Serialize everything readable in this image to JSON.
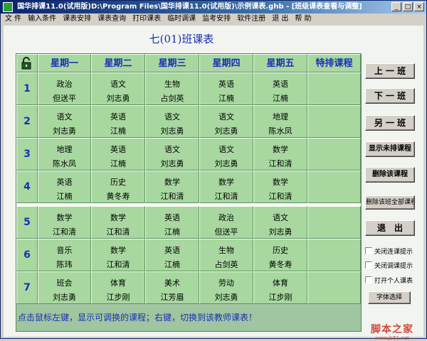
{
  "window": {
    "title": "国华排课11.0(试用版)D:\\Program Files\\国华排课11.0(试用版)\\示例课表.ghb - [班级课表查看与调整]",
    "buttons": [
      "_",
      "□",
      "×"
    ]
  },
  "menu": [
    "文 件",
    "输入条件",
    "课表安排",
    "课表查询",
    "打印课表",
    "临时调课",
    "监考安排",
    "软件注册",
    "退 出",
    "帮 助"
  ],
  "schedule": {
    "title": "七(01)班课表",
    "days": [
      "星期一",
      "星期二",
      "星期三",
      "星期四",
      "星期五",
      "特排课程"
    ],
    "rows": [
      {
        "period": "1",
        "cells": [
          {
            "subject": "政治",
            "teacher": "但送平"
          },
          {
            "subject": "语文",
            "teacher": "刘志勇"
          },
          {
            "subject": "生物",
            "teacher": "占剑英"
          },
          {
            "subject": "英语",
            "teacher": "江楠"
          },
          {
            "subject": "英语",
            "teacher": "江楠"
          },
          {
            "subject": "",
            "teacher": ""
          }
        ]
      },
      {
        "period": "2",
        "cells": [
          {
            "subject": "语文",
            "teacher": "刘志勇"
          },
          {
            "subject": "英语",
            "teacher": "江楠"
          },
          {
            "subject": "语文",
            "teacher": "刘志勇"
          },
          {
            "subject": "语文",
            "teacher": "刘志勇"
          },
          {
            "subject": "地理",
            "teacher": "陈水凤"
          },
          {
            "subject": "",
            "teacher": ""
          }
        ]
      },
      {
        "period": "3",
        "cells": [
          {
            "subject": "地理",
            "teacher": "陈水凤"
          },
          {
            "subject": "英语",
            "teacher": "江楠"
          },
          {
            "subject": "语文",
            "teacher": "刘志勇"
          },
          {
            "subject": "语文",
            "teacher": "刘志勇"
          },
          {
            "subject": "数学",
            "teacher": "江和清"
          },
          {
            "subject": "",
            "teacher": ""
          }
        ]
      },
      {
        "period": "4",
        "cells": [
          {
            "subject": "英语",
            "teacher": "江楠"
          },
          {
            "subject": "历史",
            "teacher": "黄冬寿"
          },
          {
            "subject": "数学",
            "teacher": "江和清"
          },
          {
            "subject": "数学",
            "teacher": "江和清"
          },
          {
            "subject": "数学",
            "teacher": "江和清"
          },
          {
            "subject": "",
            "teacher": ""
          }
        ]
      },
      {
        "period": "5",
        "cells": [
          {
            "subject": "数学",
            "teacher": "江和清"
          },
          {
            "subject": "数学",
            "teacher": "江和清"
          },
          {
            "subject": "英语",
            "teacher": "江楠"
          },
          {
            "subject": "政治",
            "teacher": "但送平"
          },
          {
            "subject": "语文",
            "teacher": "刘志勇"
          },
          {
            "subject": "",
            "teacher": ""
          }
        ]
      },
      {
        "period": "6",
        "cells": [
          {
            "subject": "音乐",
            "teacher": "陈玮"
          },
          {
            "subject": "数学",
            "teacher": "江和清"
          },
          {
            "subject": "英语",
            "teacher": "江楠"
          },
          {
            "subject": "生物",
            "teacher": "占剑英"
          },
          {
            "subject": "历史",
            "teacher": "黄冬寿"
          },
          {
            "subject": "",
            "teacher": ""
          }
        ]
      },
      {
        "period": "7",
        "cells": [
          {
            "subject": "班会",
            "teacher": "刘志勇"
          },
          {
            "subject": "体育",
            "teacher": "江步刚"
          },
          {
            "subject": "美术",
            "teacher": "江芳眉"
          },
          {
            "subject": "劳动",
            "teacher": "刘志勇"
          },
          {
            "subject": "体育",
            "teacher": "江步刚"
          },
          {
            "subject": "",
            "teacher": ""
          }
        ]
      }
    ]
  },
  "side": {
    "prev_class": "上 一 班",
    "next_class": "下 一 班",
    "other_class": "另 一 班",
    "show_unscheduled": "显示未排课程",
    "delete_course": "删除该课程",
    "delete_all": "删除该班全部课程",
    "exit": "退　出",
    "chk_close_conflict": "关闭连课提示",
    "chk_close_adjust": "关闭调课提示",
    "chk_open_personal": "打开个人课表",
    "font_select": "字体选择"
  },
  "hint": "点击鼠标左键，显示可调换的课程；右键，切换到该教师课表！",
  "watermark": {
    "line1": "脚本之家",
    "line2": "www.jb51.net"
  },
  "colors": {
    "cell_bg": "#a8d8a0",
    "header_text": "#1a2fb5",
    "hint_text": "#1a2fb5",
    "title_bar": "#0a246a"
  }
}
